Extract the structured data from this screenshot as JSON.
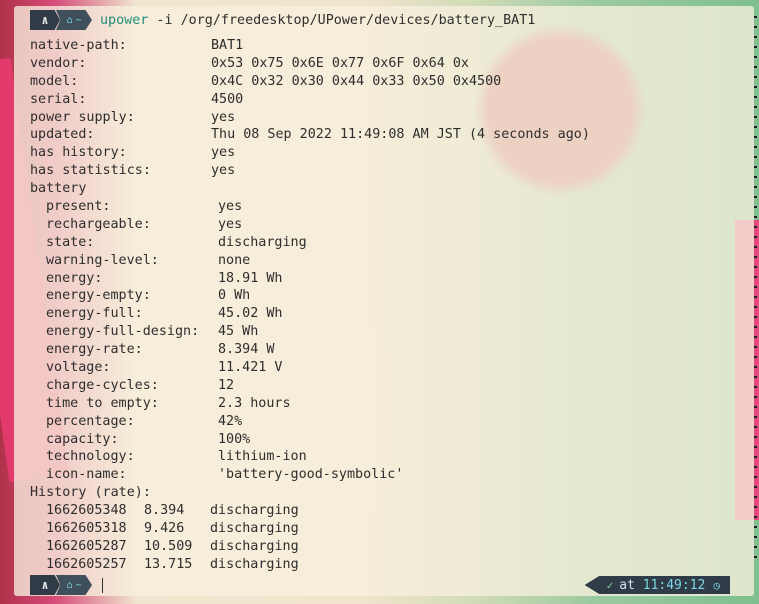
{
  "prompt": {
    "seg_a": "∧",
    "seg_b": "~",
    "command_prog": "upower",
    "command_args": " -i /org/freedesktop/UPower/devices/battery_BAT1"
  },
  "device": [
    {
      "key": "native-path:",
      "value": "BAT1"
    },
    {
      "key": "vendor:",
      "value": "0x53 0x75 0x6E 0x77 0x6F 0x64 0x"
    },
    {
      "key": "model:",
      "value": "0x4C 0x32 0x30 0x44 0x33 0x50 0x4500"
    },
    {
      "key": "serial:",
      "value": "4500"
    },
    {
      "key": "power supply:",
      "value": "yes"
    },
    {
      "key": "updated:",
      "value": "Thu 08 Sep 2022 11:49:08 AM JST (4 seconds ago)"
    },
    {
      "key": "has history:",
      "value": "yes"
    },
    {
      "key": "has statistics:",
      "value": "yes"
    }
  ],
  "battery_header": "battery",
  "battery": [
    {
      "key": "present:",
      "value": "yes"
    },
    {
      "key": "rechargeable:",
      "value": "yes"
    },
    {
      "key": "state:",
      "value": "discharging"
    },
    {
      "key": "warning-level:",
      "value": "none"
    },
    {
      "key": "energy:",
      "value": "18.91 Wh"
    },
    {
      "key": "energy-empty:",
      "value": "0 Wh"
    },
    {
      "key": "energy-full:",
      "value": "45.02 Wh"
    },
    {
      "key": "energy-full-design:",
      "value": "45 Wh"
    },
    {
      "key": "energy-rate:",
      "value": "8.394 W"
    },
    {
      "key": "voltage:",
      "value": "11.421 V"
    },
    {
      "key": "charge-cycles:",
      "value": "12"
    },
    {
      "key": "time to empty:",
      "value": "2.3 hours"
    },
    {
      "key": "percentage:",
      "value": "42%"
    },
    {
      "key": "capacity:",
      "value": "100%"
    },
    {
      "key": "technology:",
      "value": "lithium-ion"
    },
    {
      "key": "icon-name:",
      "value": "'battery-good-symbolic'"
    }
  ],
  "history_header": "History (rate):",
  "history": [
    {
      "ts": "1662605348",
      "rate": "8.394",
      "state": "discharging"
    },
    {
      "ts": "1662605318",
      "rate": "9.426",
      "state": "discharging"
    },
    {
      "ts": "1662605287",
      "rate": "10.509",
      "state": "discharging"
    },
    {
      "ts": "1662605257",
      "rate": "13.715",
      "state": "discharging"
    }
  ],
  "status": {
    "check": "✓",
    "at_label": "at ",
    "time": "11:49:12",
    "clock_icon": "clock-icon"
  },
  "colors": {
    "prog": "#1f8f7a",
    "powerline_dark": "#2f3b46",
    "powerline_accent": "#7fd6e4"
  }
}
